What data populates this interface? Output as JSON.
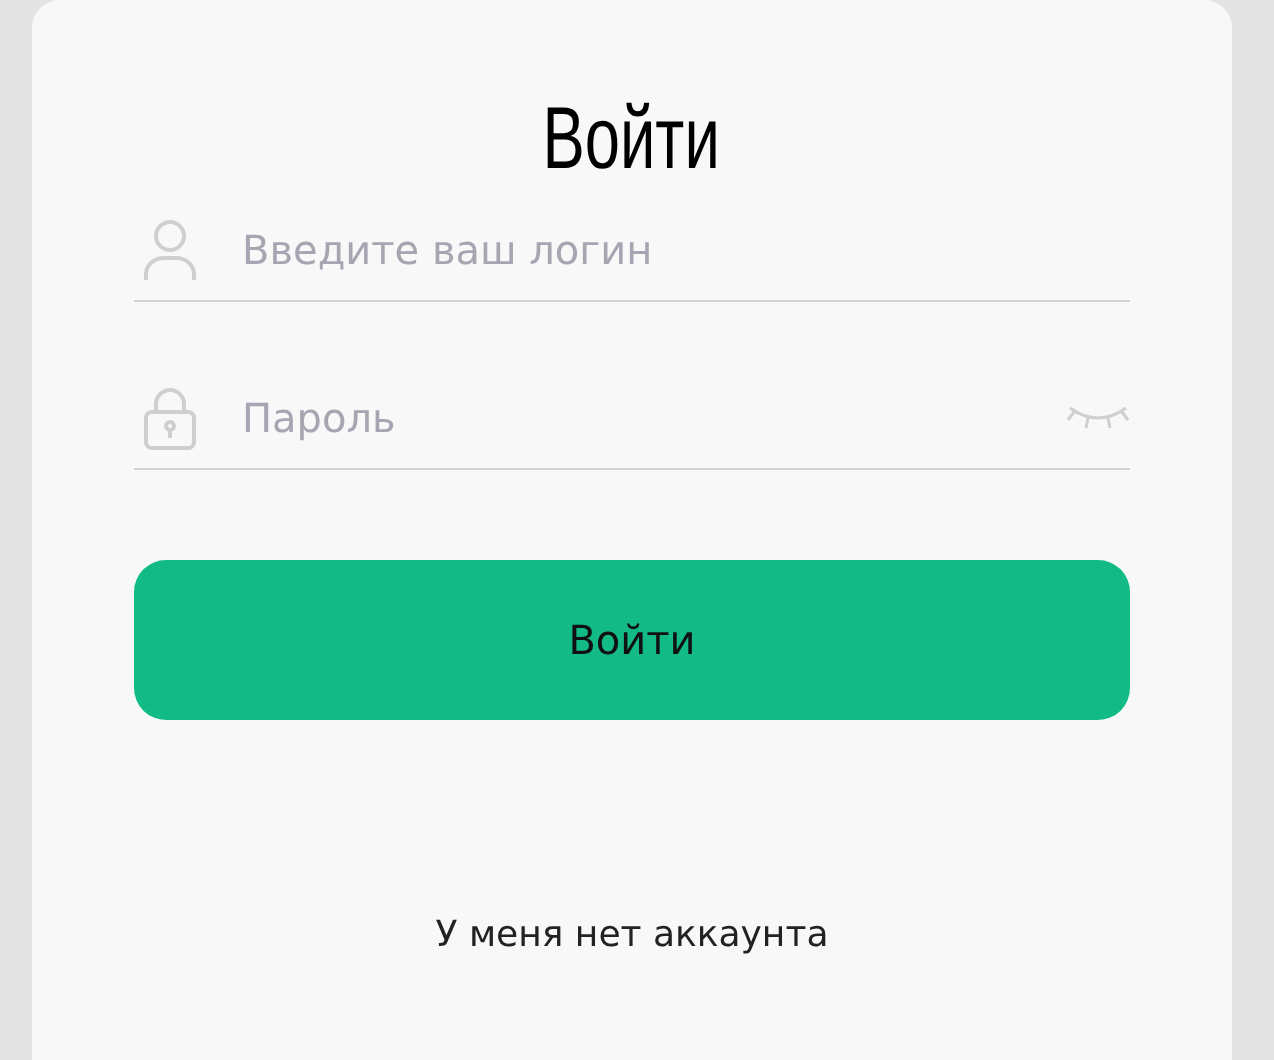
{
  "title": "Войти",
  "fields": [
    {
      "kind": "login",
      "placeholder": "Введите ваш логин"
    },
    {
      "kind": "password",
      "placeholder": "Пароль"
    }
  ],
  "submit": "Войти",
  "register_link": "У меня нет аккаунта"
}
